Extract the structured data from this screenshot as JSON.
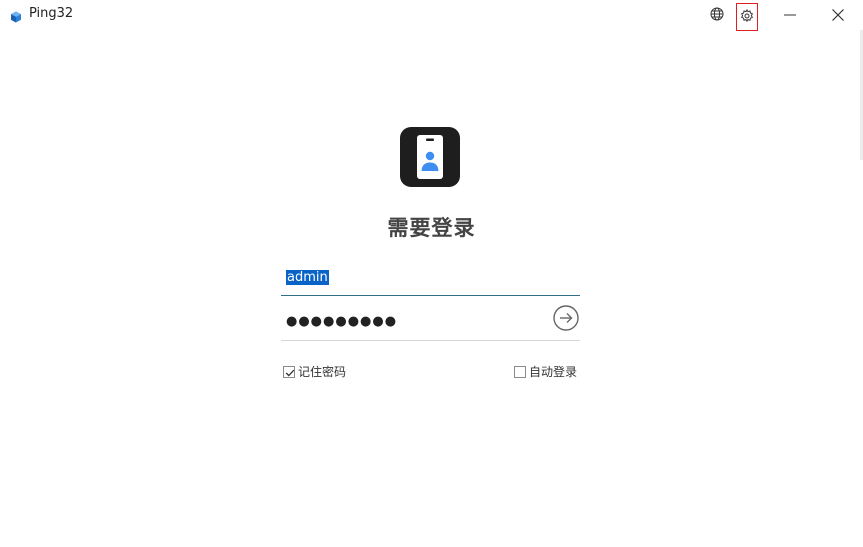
{
  "app": {
    "title": "Ping32"
  },
  "titlebar": {
    "language_icon": "globe-icon",
    "settings_icon": "gear-icon",
    "minimize_icon": "minimize-icon",
    "close_icon": "close-icon"
  },
  "login": {
    "heading": "需要登录",
    "username_value": "admin",
    "password_mask": "●●●●●●●●●",
    "submit_icon": "arrow-right-circle-icon",
    "remember_label": "记住密码",
    "remember_checked": true,
    "autologin_label": "自动登录",
    "autologin_checked": false
  },
  "colors": {
    "accent": "#2f6f8a",
    "selection": "#0a64c8",
    "logo_bg": "#1e1e1e",
    "logo_person": "#3d8ef0",
    "highlight_border": "#e02020"
  }
}
